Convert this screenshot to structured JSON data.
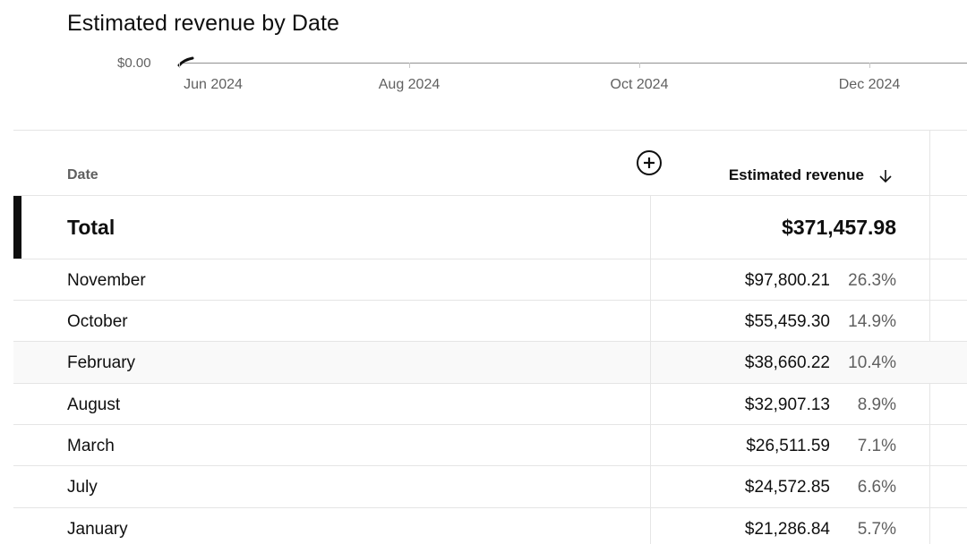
{
  "chart": {
    "title": "Estimated revenue by Date",
    "y_tick_label": "$0.00",
    "x_ticks": [
      "Jun 2024",
      "Aug 2024",
      "Oct 2024",
      "Dec 2024"
    ]
  },
  "chart_data": {
    "type": "line",
    "title": "Estimated revenue by Date",
    "xlabel": "",
    "ylabel": "",
    "x_tick_labels": [
      "Jun 2024",
      "Aug 2024",
      "Oct 2024",
      "Dec 2024"
    ],
    "y_tick_labels": [
      "$0.00"
    ],
    "series": [
      {
        "values": []
      }
    ],
    "grid": false
  },
  "table": {
    "header": {
      "date": "Date",
      "metric": "Estimated revenue",
      "sort_icon": "arrow-down-icon",
      "add_icon": "add-circle-icon"
    },
    "total": {
      "label": "Total",
      "value": "$371,457.98"
    },
    "rows": [
      {
        "date": "November",
        "revenue": "$97,800.21",
        "pct": "26.3%"
      },
      {
        "date": "October",
        "revenue": "$55,459.30",
        "pct": "14.9%"
      },
      {
        "date": "February",
        "revenue": "$38,660.22",
        "pct": "10.4%"
      },
      {
        "date": "August",
        "revenue": "$32,907.13",
        "pct": "8.9%"
      },
      {
        "date": "March",
        "revenue": "$26,511.59",
        "pct": "7.1%"
      },
      {
        "date": "July",
        "revenue": "$24,572.85",
        "pct": "6.6%"
      },
      {
        "date": "January",
        "revenue": "$21,286.84",
        "pct": "5.7%"
      }
    ]
  },
  "colors": {
    "text": "#0f0f0f",
    "muted": "#606060",
    "divider": "#e5e5e5",
    "highlight_row": "#f9f9f9",
    "total_bar": "#0f0f0f"
  }
}
